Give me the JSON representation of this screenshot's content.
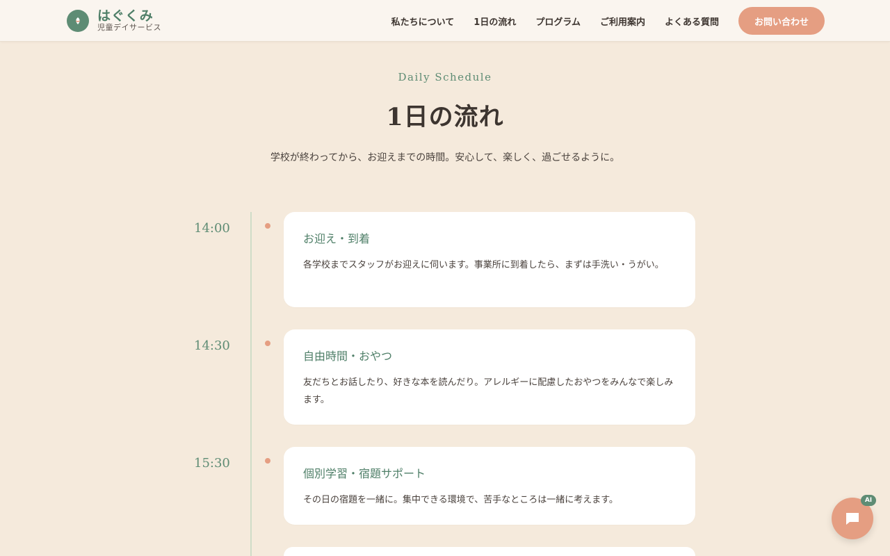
{
  "header": {
    "logo_name": "はぐくみ",
    "logo_sub": "児童デイサービス",
    "nav": [
      "私たちについて",
      "1日の流れ",
      "プログラム",
      "ご利用案内",
      "よくある質問"
    ],
    "cta_label": "お問い合わせ"
  },
  "section": {
    "eyebrow": "Daily Schedule",
    "title": "1日の流れ",
    "lead": "学校が終わってから、お迎えまでの時間。安心して、楽しく、過ごせるように。"
  },
  "schedule": [
    {
      "time": "14:00",
      "title": "お迎え・到着",
      "text": "各学校までスタッフがお迎えに伺います。事業所に到着したら、まずは手洗い・うがい。"
    },
    {
      "time": "14:30",
      "title": "自由時間・おやつ",
      "text": "友だちとお話したり、好きな本を読んだり。アレルギーに配慮したおやつをみんなで楽しみます。"
    },
    {
      "time": "15:30",
      "title": "個別学習・宿題サポート",
      "text": "その日の宿題を一緒に。集中できる環境で、苦手なところは一緒に考えます。"
    }
  ],
  "chat": {
    "badge": "AI",
    "icon": "chat-bubble-icon"
  },
  "colors": {
    "accent": "#e59e82",
    "brand": "#5e8c74",
    "background": "#f5eadc"
  }
}
